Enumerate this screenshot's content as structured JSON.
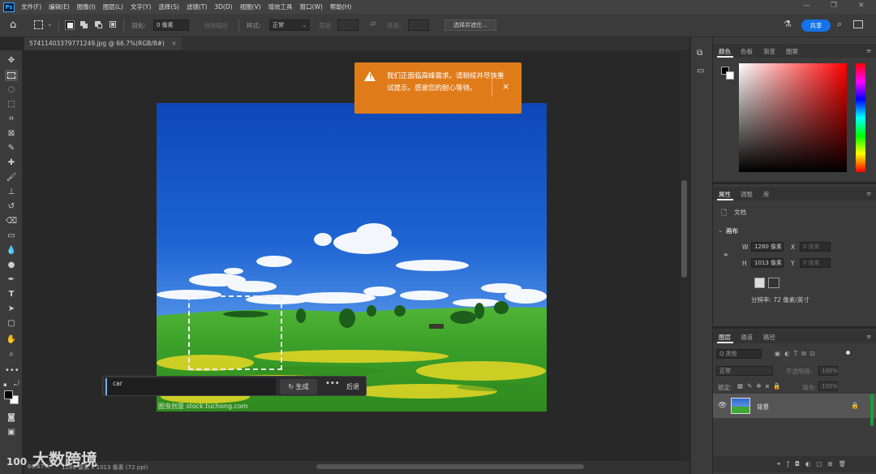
{
  "app": {
    "logo": "Ps"
  },
  "menu": [
    "文件(F)",
    "编辑(E)",
    "图像(I)",
    "图层(L)",
    "文字(Y)",
    "选择(S)",
    "滤镜(T)",
    "3D(D)",
    "视图(V)",
    "增效工具",
    "窗口(W)",
    "帮助(H)"
  ],
  "options": {
    "feather_label": "羽化:",
    "feather_value": "0 像素",
    "antialias_label": "消除锯齿",
    "style_label": "样式:",
    "style_value": "正常",
    "width_label": "宽度:",
    "height_label": "高度:",
    "select_subject": "选择并遮住...",
    "share": "共享"
  },
  "document": {
    "tab_title": "57411403379771249.jpg @ 66.7%(RGB/8#)"
  },
  "status": {
    "zoom": "66.67%",
    "doc_info": "1280 像素 x 1013 像素 (72 ppi)"
  },
  "toast": {
    "message": "我们正面临高峰需求。请稍候并尽快重试提示。感谢您的耐心等待。",
    "close": "×"
  },
  "generative": {
    "prompt": "car",
    "generate_label": "生成",
    "more": "•••",
    "back_label": "后退"
  },
  "watermark_text": "图虫创意 stock.tuchong.com",
  "brand_watermark": {
    "mark": "100",
    "text": "大数跨境"
  },
  "panels": {
    "color_tabs": [
      "颜色",
      "色板",
      "渐变",
      "图案"
    ],
    "properties_tabs": [
      "属性",
      "调整",
      "库"
    ],
    "doc_label": "文档",
    "canvas_heading": "画布",
    "w_label": "W",
    "w_value": "1280 像素",
    "h_label": "H",
    "h_value": "1013 像素",
    "x_label": "X",
    "x_placeholder": "0 像素",
    "y_label": "Y",
    "y_placeholder": "0 像素",
    "resolution": "分辨率: 72 像素/英寸",
    "layers_tabs": [
      "图层",
      "通道",
      "路径"
    ],
    "layer_filter": "Q 类型",
    "blend_mode": "正常",
    "opacity_label": "不透明度:",
    "opacity_value": "100%",
    "lock_label": "锁定:",
    "fill_label": "填充:",
    "fill_value": "100%",
    "layer_name": "背景"
  },
  "colors": {
    "accent": "#1473e6",
    "toast": "#e07b1a"
  }
}
